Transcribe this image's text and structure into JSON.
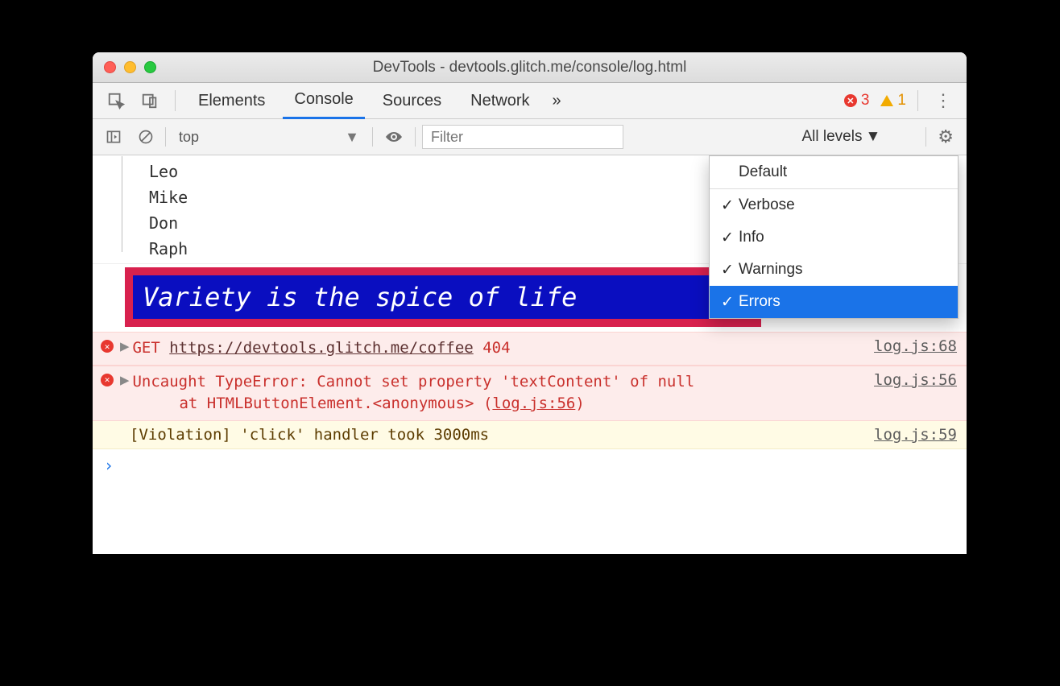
{
  "window": {
    "title": "DevTools - devtools.glitch.me/console/log.html"
  },
  "tabs": {
    "elements": "Elements",
    "console": "Console",
    "sources": "Sources",
    "network": "Network",
    "more": "»"
  },
  "counts": {
    "errors": "3",
    "warnings": "1"
  },
  "toolbar": {
    "context": "top",
    "filter_placeholder": "Filter",
    "levels_label": "All levels"
  },
  "dropdown": {
    "default": "Default",
    "verbose": "Verbose",
    "info": "Info",
    "warnings": "Warnings",
    "errors": "Errors"
  },
  "tree": {
    "items": [
      "Leo",
      "Mike",
      "Don",
      "Raph"
    ]
  },
  "styled_log": "Variety is the spice of life",
  "rows": {
    "get": {
      "method": "GET",
      "url": "https://devtools.glitch.me/coffee",
      "status": "404",
      "src": "log.js:68"
    },
    "typeerror": {
      "msg": "Uncaught TypeError: Cannot set property 'textContent' of null",
      "stack_prefix": "at HTMLButtonElement.<anonymous> (",
      "stack_link": "log.js:56",
      "stack_suffix": ")",
      "src": "log.js:56"
    },
    "violation": {
      "msg": "[Violation] 'click' handler took 3000ms",
      "src": "log.js:59"
    }
  },
  "prompt": "›"
}
